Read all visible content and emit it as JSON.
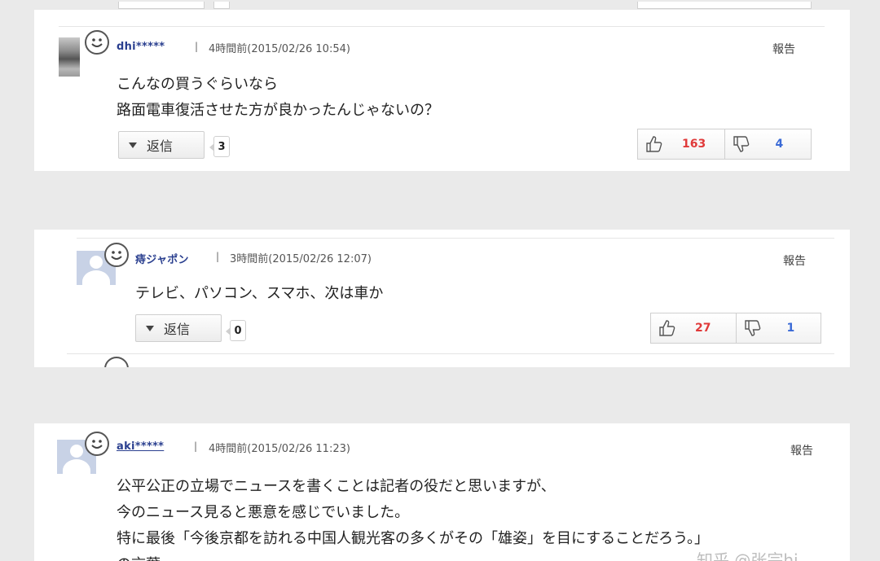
{
  "comments": [
    {
      "username": "dhi*****",
      "separator": "|",
      "timestamp": "4時間前(2015/02/26 10:54)",
      "report_label": "報告",
      "body_lines": [
        "こんなの買うぐらいなら",
        "路面電車復活させた方が良かったんじゃないの？"
      ],
      "reply_label": "返信",
      "reply_count": "3",
      "good_count": "163",
      "bad_count": "4"
    },
    {
      "username": "痔ジャポン",
      "separator": "|",
      "timestamp": "3時間前(2015/02/26 12:07)",
      "report_label": "報告",
      "body_lines": [
        "テレビ、パソコン、スマホ、次は車か"
      ],
      "reply_label": "返信",
      "reply_count": "0",
      "good_count": "27",
      "bad_count": "1"
    },
    {
      "username": "aki*****",
      "separator": "|",
      "timestamp": "4時間前(2015/02/26 11:23)",
      "report_label": "報告",
      "body_lines": [
        "公平公正の立場でニュースを書くことは記者の役だと思いますが、",
        "今のニュース見ると悪意を感じでいました。",
        "特に最後「今後京都を訪れる中国人観光客の多くがその「雄姿」を目にすることだろう。」",
        "の言葉"
      ]
    }
  ],
  "watermark": "知乎 @张宗hi",
  "icons": {
    "smile": "smile-icon",
    "thumbs_up": "thumbs-up-icon",
    "thumbs_down": "thumbs-down-icon",
    "dropdown": "triangle-down-icon"
  },
  "colors": {
    "username": "#2a3f8f",
    "good": "#e03a3a",
    "bad": "#3a6ad6",
    "background": "#eaeaea"
  }
}
